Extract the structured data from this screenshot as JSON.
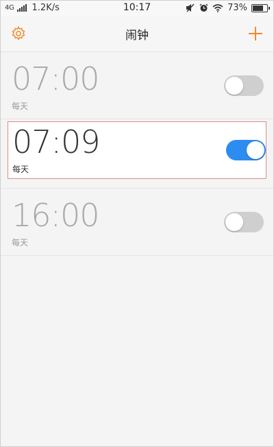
{
  "status_bar": {
    "network": "4G",
    "speed": "1.2K/s",
    "time": "10:17",
    "battery_percent": "73%",
    "battery_level": 0.73,
    "icons": [
      "mute-icon",
      "alarm-icon",
      "wifi-icon",
      "battery-icon"
    ]
  },
  "header": {
    "title": "闹钟",
    "settings_icon": "gear-icon",
    "add_icon": "plus-icon"
  },
  "colors": {
    "accent": "#f08a2c",
    "toggle_on": "#2d8cf0",
    "toggle_off": "#cfcfcf",
    "selected_border": "#d98c8c"
  },
  "alarms": [
    {
      "time": "07:00",
      "repeat": "每天",
      "enabled": false
    },
    {
      "time": "07:09",
      "repeat": "每天",
      "enabled": true
    },
    {
      "time": "16:00",
      "repeat": "每天",
      "enabled": false
    }
  ]
}
